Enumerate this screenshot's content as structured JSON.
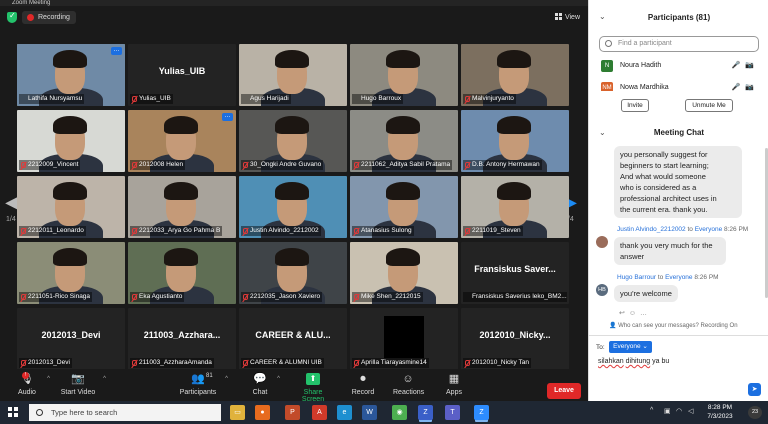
{
  "window": {
    "title": "Zoom Meeting"
  },
  "topbar": {
    "recording_label": "Recording",
    "view_label": "View"
  },
  "gallery": {
    "page_left": "1/4",
    "page_right": "1/4",
    "tiles": [
      {
        "name": "Lathifa Nursyamsu",
        "big": "",
        "video": true,
        "speaker": true,
        "muted": false,
        "bg": "#6f8aa6",
        "more": true
      },
      {
        "name": "Yulias_UIB",
        "big": "Yulias_UIB",
        "video": false,
        "muted": true
      },
      {
        "name": "Agus Harijadi",
        "big": "",
        "video": true,
        "muted": false,
        "bg": "#b9b2a6"
      },
      {
        "name": "Hugo Barroux",
        "big": "",
        "video": true,
        "muted": false,
        "bg": "#8d8a80"
      },
      {
        "name": "Malvinjuryanto",
        "big": "",
        "video": true,
        "muted": true,
        "bg": "#7c6f5f"
      },
      {
        "name": "2212009_Vincent",
        "big": "",
        "video": true,
        "muted": true,
        "bg": "#d7d9d4"
      },
      {
        "name": "2012008 Helen",
        "big": "",
        "video": true,
        "muted": true,
        "bg": "#a9845c",
        "more": true
      },
      {
        "name": "30_Ongki Andre Guvano",
        "big": "",
        "video": true,
        "muted": true,
        "bg": "#575755"
      },
      {
        "name": "2211062_Aditya Sabil Pratama",
        "big": "",
        "video": true,
        "muted": true,
        "bg": "#8c8c86"
      },
      {
        "name": "D.B. Antony Hermawan",
        "big": "",
        "video": true,
        "muted": true,
        "bg": "#6e8cae"
      },
      {
        "name": "2212011_Leonardo",
        "big": "",
        "video": true,
        "muted": true,
        "bg": "#bdb4a9"
      },
      {
        "name": "2212033_Arya Go Pahma B",
        "big": "",
        "video": true,
        "muted": true,
        "bg": "#a8a39b"
      },
      {
        "name": "Justin Alvindo_2212002",
        "big": "",
        "video": true,
        "muted": true,
        "bg": "#4f8fb5"
      },
      {
        "name": "Atanasius Sulong",
        "big": "",
        "video": true,
        "muted": true,
        "bg": "#8296ad"
      },
      {
        "name": "2211019_Steven",
        "big": "",
        "video": true,
        "muted": true,
        "bg": "#b4b1a8"
      },
      {
        "name": "2211051-Rico Sinaga",
        "big": "",
        "video": true,
        "muted": true,
        "bg": "#8b8d77"
      },
      {
        "name": "Eka Agustianto",
        "big": "",
        "video": true,
        "muted": true,
        "bg": "#5f6e54"
      },
      {
        "name": "2212035_Jason Xaviero",
        "big": "",
        "video": true,
        "muted": true,
        "bg": "#3f4448"
      },
      {
        "name": "Mike Shen_2212015",
        "big": "",
        "video": true,
        "muted": true,
        "bg": "#c9c1b1"
      },
      {
        "name": "Fransiskus Saverius leko_BM2...",
        "big": "Fransiskus Saver...",
        "video": false,
        "muted": false
      },
      {
        "name": "2012013_Devi",
        "big": "2012013_Devi",
        "video": false,
        "muted": true
      },
      {
        "name": "211003_AzzharaAmanda",
        "big": "211003_Azzhara...",
        "video": false,
        "muted": true
      },
      {
        "name": "CAREER & ALUMNI UIB",
        "big": "CAREER & ALU...",
        "video": false,
        "muted": true
      },
      {
        "name": "Aprilla Tiarayasmine14",
        "big": "",
        "video": false,
        "black": true,
        "muted": true
      },
      {
        "name": "2012010_Nicky Tan",
        "big": "2012010_Nicky...",
        "video": false,
        "muted": true
      }
    ]
  },
  "toolbar": {
    "audio": "Audio",
    "video": "Start Video",
    "participants": "Participants",
    "participants_count": "81",
    "chat": "Chat",
    "share": "Share Screen",
    "record": "Record",
    "reactions": "Reactions",
    "apps": "Apps",
    "leave": "Leave"
  },
  "participants_panel": {
    "title": "Participants (81)",
    "search_placeholder": "Find a participant",
    "rows": [
      {
        "initials": "N",
        "name": "Noura Hadith",
        "color": "#2e7d32"
      },
      {
        "initials": "NM",
        "name": "Nowa Mardhika",
        "color": "#d9622b"
      }
    ],
    "invite": "Invite",
    "unmute_me": "Unmute Me"
  },
  "chat": {
    "title": "Meeting Chat",
    "first_bubble": [
      "you personally suggest for",
      "beginners to start learning;",
      "And what would someone",
      "who is considered as a",
      "professional architect uses in",
      "the current era. thank you."
    ],
    "msg1": {
      "from": "Justin Alvindo_2212002",
      "to": "Everyone",
      "time": "8:26 PM",
      "lines": [
        "thank you very much for the",
        "answer"
      ]
    },
    "msg2": {
      "from": "Hugo Barrour",
      "to": "Everyone",
      "time": "8:26 PM",
      "initials": "HB",
      "lines": [
        "you're welcome"
      ]
    },
    "to_word": "to",
    "note": "Who can see your messages? Recording On",
    "to_label": "To:",
    "recipient": "Everyone",
    "draft_word1": "silahkan",
    "draft_word2": "dihitung",
    "draft_rest": "ya bu"
  },
  "taskbar": {
    "search_placeholder": "Type here to search",
    "time": "8:28 PM",
    "date": "7/3/2023",
    "notification_count": "23"
  }
}
